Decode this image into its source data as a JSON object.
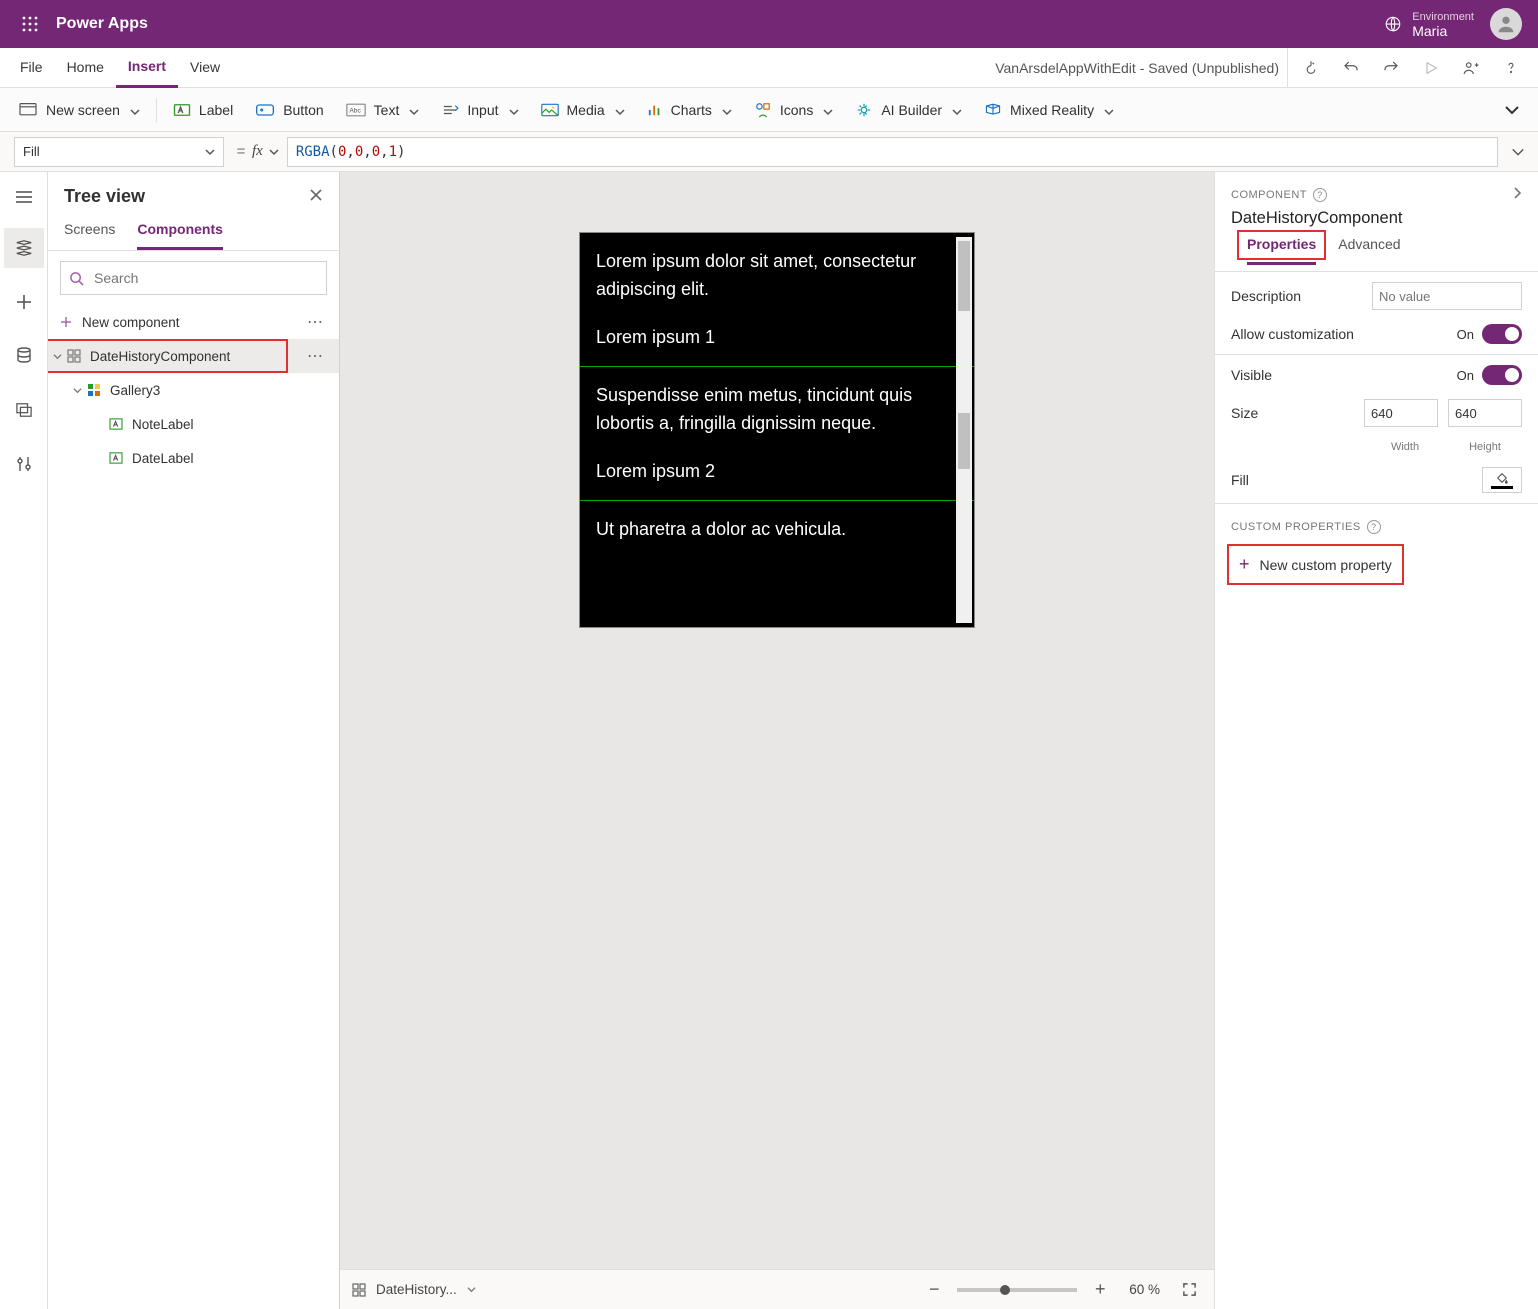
{
  "header": {
    "brand": "Power Apps",
    "env_label": "Environment",
    "env_name": "Maria"
  },
  "menu": {
    "items": [
      "File",
      "Home",
      "Insert",
      "View"
    ],
    "active": "Insert",
    "doc_title": "VanArsdelAppWithEdit - Saved (Unpublished)"
  },
  "ribbon": {
    "new_screen": "New screen",
    "label": "Label",
    "button": "Button",
    "text": "Text",
    "input": "Input",
    "media": "Media",
    "charts": "Charts",
    "icons": "Icons",
    "ai": "AI Builder",
    "mr": "Mixed Reality"
  },
  "formula": {
    "property": "Fill",
    "eq": "=",
    "fx": "fx",
    "fn": "RGBA",
    "args": [
      "0",
      "0",
      "0",
      "1"
    ]
  },
  "tree": {
    "title": "Tree view",
    "tabs": [
      "Screens",
      "Components"
    ],
    "active_tab": "Components",
    "search_placeholder": "Search",
    "new_component": "New component",
    "nodes": {
      "root": "DateHistoryComponent",
      "gallery": "Gallery3",
      "c1": "NoteLabel",
      "c2": "DateLabel"
    }
  },
  "canvas": {
    "rows": [
      {
        "note": "Lorem ipsum dolor sit amet, consectetur adipiscing elit.",
        "date": "Lorem ipsum 1"
      },
      {
        "note": "Suspendisse enim metus, tincidunt quis lobortis a, fringilla dignissim neque.",
        "date": "Lorem ipsum 2"
      },
      {
        "note": "Ut pharetra a dolor ac vehicula.",
        "date": ""
      }
    ],
    "status_name": "DateHistory...",
    "zoom": "60 %"
  },
  "props": {
    "kind": "COMPONENT",
    "name": "DateHistoryComponent",
    "tabs": [
      "Properties",
      "Advanced"
    ],
    "active_tab": "Properties",
    "rows": {
      "description": "Description",
      "description_ph": "No value",
      "allow_custom": "Allow customization",
      "visible": "Visible",
      "size": "Size",
      "width": "640",
      "height": "640",
      "width_lbl": "Width",
      "height_lbl": "Height",
      "fill": "Fill",
      "on": "On"
    },
    "custom_hdr": "CUSTOM PROPERTIES",
    "new_custom": "New custom property"
  }
}
